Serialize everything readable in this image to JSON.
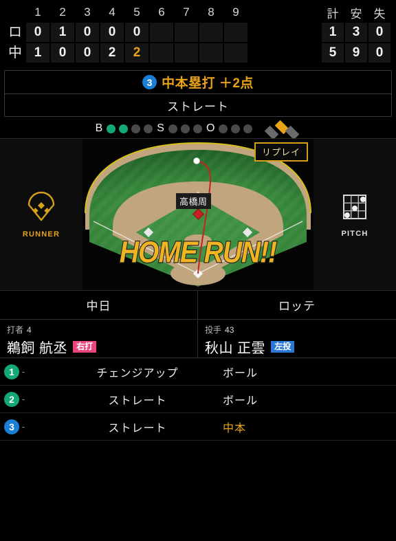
{
  "scoreboard": {
    "inning_headers": [
      "1",
      "2",
      "3",
      "4",
      "5",
      "6",
      "7",
      "8",
      "9"
    ],
    "total_headers": [
      "計",
      "安",
      "失"
    ],
    "rows": [
      {
        "team": "ロ",
        "innings": [
          "0",
          "1",
          "0",
          "0",
          "0",
          "",
          "",
          "",
          ""
        ],
        "highlight_inning": -1,
        "totals": [
          "1",
          "3",
          "0"
        ]
      },
      {
        "team": "中",
        "innings": [
          "1",
          "0",
          "0",
          "2",
          "2",
          "",
          "",
          "",
          ""
        ],
        "highlight_inning": 4,
        "totals": [
          "5",
          "9",
          "0"
        ]
      }
    ]
  },
  "banner": {
    "pitch_number": "3",
    "event_text": "中本塁打 ＋2点",
    "pitch_type": "ストレート",
    "accent_color": "#e8a317",
    "badge_color": "#1a7fd4"
  },
  "count": {
    "ball_label": "B",
    "strike_label": "S",
    "out_label": "O",
    "balls": 2,
    "ball_max": 4,
    "strikes": 0,
    "strike_max": 3,
    "outs": 0,
    "out_max": 3,
    "ball_on_color": "#15a877",
    "bases": {
      "first": false,
      "second": true,
      "third": false
    }
  },
  "play": {
    "runner_button_label": "RUNNER",
    "pitch_button_label": "PITCH",
    "replay_label": "リプレイ",
    "fielder_label": "高橋周",
    "result_text": "HOME RUN!!"
  },
  "teams": {
    "home": "中日",
    "away": "ロッテ"
  },
  "matchup": {
    "batter": {
      "role": "打者",
      "number": "4",
      "name": "鵜飼 航丞",
      "tag": "右打",
      "tag_color": "#e8467c"
    },
    "pitcher": {
      "role": "投手",
      "number": "43",
      "name": "秋山 正雲",
      "tag": "左投",
      "tag_color": "#2878d8"
    }
  },
  "pitch_log": [
    {
      "num": "1",
      "color": "#15a877",
      "speed": "-",
      "type": "チェンジアップ",
      "result": "ボール",
      "result_highlight": false
    },
    {
      "num": "2",
      "color": "#15a877",
      "speed": "-",
      "type": "ストレート",
      "result": "ボール",
      "result_highlight": false
    },
    {
      "num": "3",
      "color": "#1a7fd4",
      "speed": "-",
      "type": "ストレート",
      "result": "中本",
      "result_highlight": true
    }
  ]
}
